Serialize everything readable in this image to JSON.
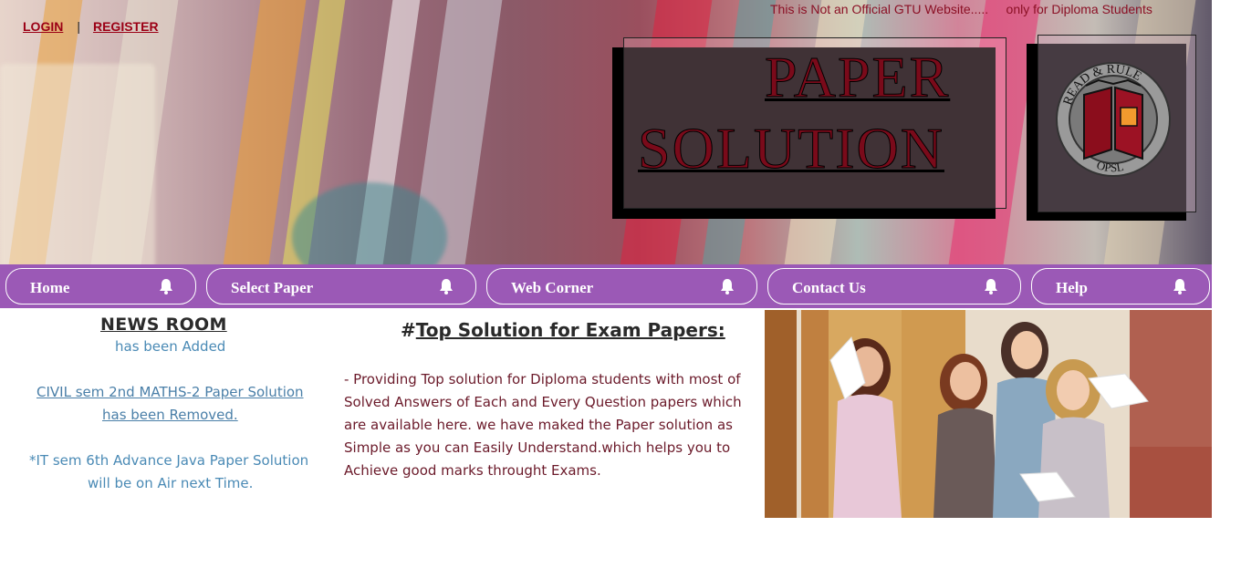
{
  "auth": {
    "login": "LOGIN",
    "separator": "|",
    "register": "REGISTER"
  },
  "disclaimer": "This is Not an Official GTU Website.....     only for Diploma Students",
  "brand": {
    "line1": "PAPER",
    "line2": "SOLUTION",
    "logo_top": "READ & RULE",
    "logo_bottom": "OPSL"
  },
  "nav": {
    "items": [
      {
        "label": "Home",
        "icon": "bell-icon"
      },
      {
        "label": "Select Paper",
        "icon": "bell-icon"
      },
      {
        "label": "Web Corner",
        "icon": "bell-icon"
      },
      {
        "label": "Contact Us",
        "icon": "bell-icon"
      },
      {
        "label": "Help",
        "icon": "bell-icon"
      }
    ]
  },
  "news": {
    "title": "NEWS ROOM",
    "line1": "has been Added",
    "line2": "CIVIL sem 2nd MATHS-2 Paper Solution",
    "line3": "has been Removed.",
    "line4": "*IT sem 6th Advance Java Paper Solution",
    "line5": "will be on Air next Time."
  },
  "solution": {
    "hash": "#",
    "title": "Top Solution for Exam Papers:",
    "body": " - Providing Top solution for Diploma students with most of Solved Answers of Each and Every Question papers which are available here. we have maked the Paper solution as Simple as you can Easily Understand.which helps you to Achieve good marks throught Exams."
  },
  "colors": {
    "nav_bg": "#9b59b6",
    "brand": "#7a0a1a",
    "news_text": "#4a8ab5",
    "body_text": "#6b1a2a"
  }
}
